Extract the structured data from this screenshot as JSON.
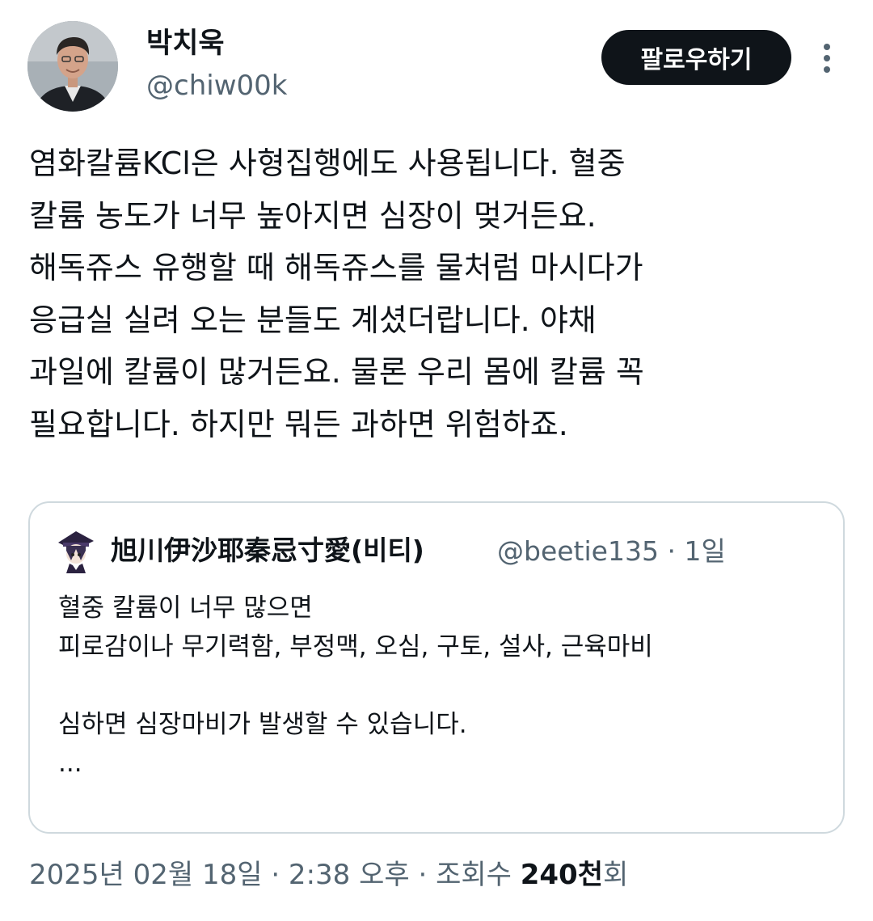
{
  "author": {
    "display_name": "박치욱",
    "handle": "@chiw00k",
    "avatar": "profile-photo"
  },
  "follow_button_label": "팔로우하기",
  "more_icon": "more-vertical-icon",
  "tweet_lines": [
    "염화칼륨KCl은 사형집행에도 사용됩니다. 혈중",
    "칼륨 농도가 너무 높아지면 심장이 멎거든요.",
    "해독쥬스 유행할 때 해독쥬스를 물처럼 마시다가",
    "응급실 실려 오는 분들도 계셨더랍니다. 야채",
    "과일에 칼륨이 많거든요. 물론 우리 몸에 칼륨 꼭",
    "필요합니다. 하지만 뭐든 과하면 위험하죠."
  ],
  "quote": {
    "display_name": "旭川伊沙耶秦忌寸愛(비티)",
    "handle": "@beetie135",
    "separator": "·",
    "time": "1일",
    "lines": [
      "혈중 칼륨이 너무 많으면",
      "피로감이나 무기력함, 부정맥, 오심, 구토, 설사, 근육마비",
      "",
      "심하면 심장마비가 발생할 수 있습니다.",
      "..."
    ]
  },
  "footer": {
    "datetime": "2025년 02월 18일 · 2:38 오후 · 조회수 ",
    "views_number": "240천",
    "views_suffix": "회"
  },
  "colors": {
    "text_primary": "#0f1419",
    "text_secondary": "#536471",
    "border": "#cfd9de",
    "button_bg": "#0f1419"
  }
}
